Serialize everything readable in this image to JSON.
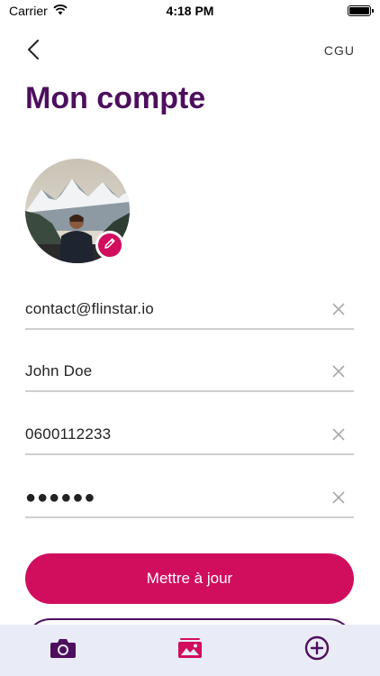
{
  "status_bar": {
    "carrier": "Carrier",
    "time": "4:18 PM",
    "icons": [
      "wifi-icon",
      "battery-icon"
    ]
  },
  "nav": {
    "back_icon": "chevron-left-icon",
    "cgu_label": "CGU"
  },
  "page_title": "Mon compte",
  "profile": {
    "edit_icon": "pencil-icon"
  },
  "fields": {
    "email": {
      "value": "contact@flinstar.io"
    },
    "name": {
      "value": "John Doe"
    },
    "phone": {
      "value": "0600112233"
    },
    "password": {
      "value": "●●●●●●"
    },
    "clear_icon": "clear-x-icon"
  },
  "buttons": {
    "update_label": "Mettre à jour"
  },
  "tab_bar": {
    "items": [
      "camera-icon",
      "gallery-icon",
      "add-circle-icon"
    ]
  },
  "colors": {
    "title": "#4d0f5d",
    "accent": "#d10d5e",
    "tab_bar_bg": "#e9ebf6",
    "divider": "#cfcfcf"
  }
}
